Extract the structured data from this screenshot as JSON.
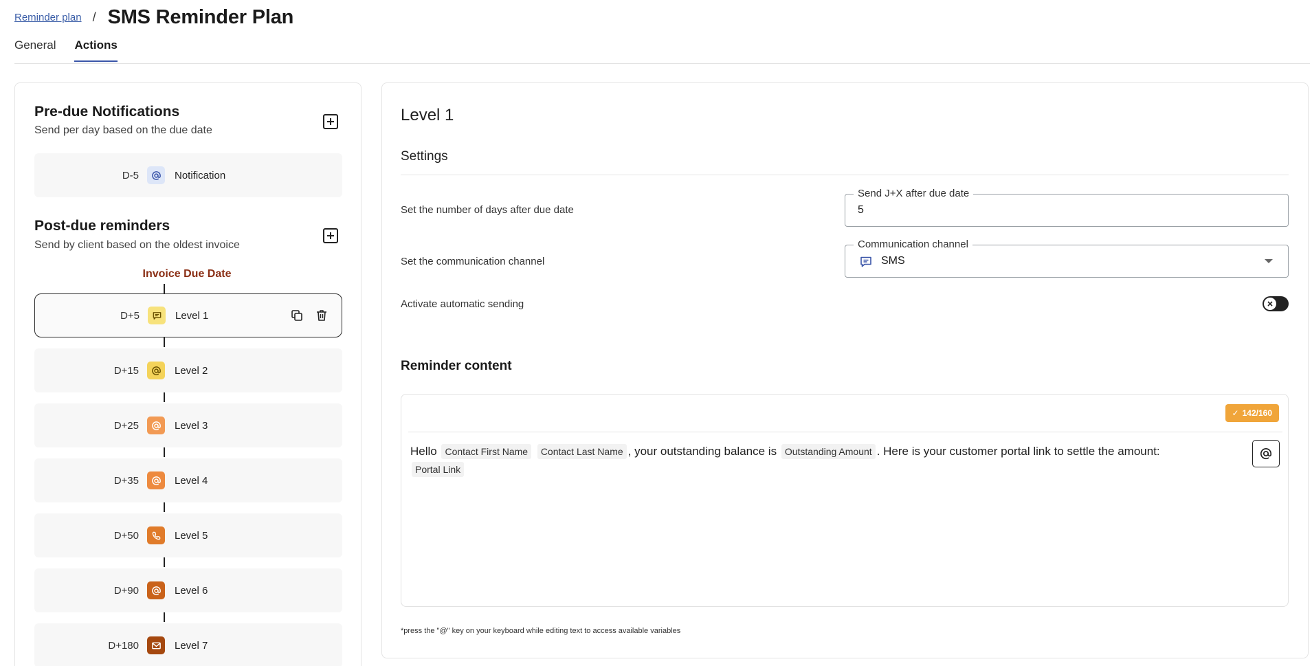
{
  "header": {
    "breadcrumb_link": "Reminder plan",
    "breadcrumb_sep": "/",
    "title": "SMS Reminder Plan"
  },
  "tabs": [
    {
      "label": "General",
      "active": false
    },
    {
      "label": "Actions",
      "active": true
    }
  ],
  "left": {
    "pre_due": {
      "title": "Pre-due Notifications",
      "subtitle": "Send per day based on the due date",
      "items": [
        {
          "day": "D-5",
          "label": "Notification",
          "channel": "email",
          "icon": "at-icon",
          "icon_bg": "#dde6f8",
          "icon_color": "#3a55a8"
        }
      ]
    },
    "post_due": {
      "title": "Post-due reminders",
      "subtitle": "Send by client based on the oldest invoice",
      "due_label": "Invoice Due Date",
      "items": [
        {
          "day": "D+5",
          "label": "Level 1",
          "channel": "sms",
          "icon": "message-icon",
          "icon_bg": "#f7e27c",
          "icon_color": "#6b5200",
          "selected": true
        },
        {
          "day": "D+15",
          "label": "Level 2",
          "channel": "email",
          "icon": "at-icon",
          "icon_bg": "#f4d35a",
          "icon_color": "#6b5200"
        },
        {
          "day": "D+25",
          "label": "Level 3",
          "channel": "email",
          "icon": "at-icon",
          "icon_bg": "#f29a54",
          "icon_color": "#ffffff"
        },
        {
          "day": "D+35",
          "label": "Level 4",
          "channel": "email",
          "icon": "at-icon",
          "icon_bg": "#ed8a3f",
          "icon_color": "#ffffff"
        },
        {
          "day": "D+50",
          "label": "Level 5",
          "channel": "phone",
          "icon": "phone-icon",
          "icon_bg": "#e07b2a",
          "icon_color": "#ffffff"
        },
        {
          "day": "D+90",
          "label": "Level 6",
          "channel": "email",
          "icon": "at-icon",
          "icon_bg": "#c9621a",
          "icon_color": "#ffffff"
        },
        {
          "day": "D+180",
          "label": "Level 7",
          "channel": "letter",
          "icon": "mail-icon",
          "icon_bg": "#a5480f",
          "icon_color": "#ffffff"
        }
      ]
    }
  },
  "right": {
    "level_title": "Level 1",
    "settings_title": "Settings",
    "days_row": {
      "label": "Set the number of days after due date",
      "field_legend": "Send J+X after due date",
      "value": "5"
    },
    "channel_row": {
      "label": "Set the communication channel",
      "field_legend": "Communication channel",
      "value": "SMS"
    },
    "auto_row": {
      "label": "Activate automatic sending",
      "enabled": false
    },
    "content_title": "Reminder content",
    "char_count": "142/160",
    "message": {
      "t1": "Hello",
      "v1": "Contact First Name",
      "v2": "Contact Last Name",
      "t2": ", your outstanding balance is",
      "v3": "Outstanding Amount",
      "t3": ". Here is your customer portal link to settle the amount:",
      "v4": "Portal Link"
    },
    "hint": "*press the \"@\" key on your keyboard while editing text to access available variables"
  },
  "colors": {
    "accent": "#3a55a8",
    "due_label": "#8a2e14",
    "badge": "#f0a53a"
  }
}
